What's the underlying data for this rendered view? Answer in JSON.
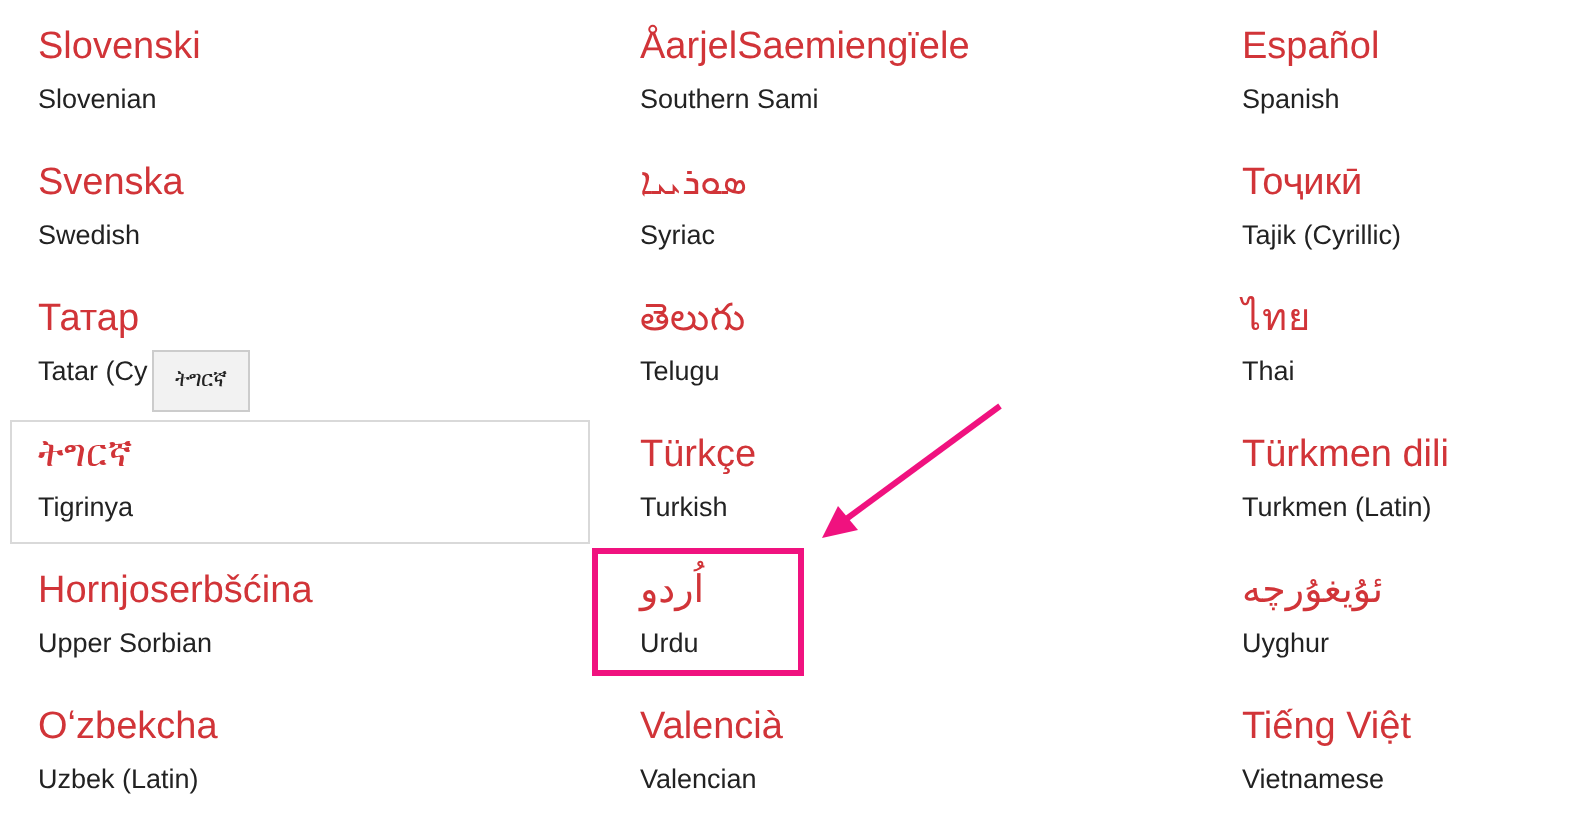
{
  "languages": [
    {
      "native": "Slovenski",
      "english": "Slovenian",
      "hovered": false,
      "highlighted": false
    },
    {
      "native": "ÅarjelSaemiengïele",
      "english": "Southern Sami",
      "hovered": false,
      "highlighted": false
    },
    {
      "native": "Español",
      "english": "Spanish",
      "hovered": false,
      "highlighted": false
    },
    {
      "native": "Svenska",
      "english": "Swedish",
      "hovered": false,
      "highlighted": false
    },
    {
      "native": "ܣܘܪܝܝܐ",
      "english": "Syriac",
      "hovered": false,
      "highlighted": false
    },
    {
      "native": "Тоҷикӣ",
      "english": "Tajik (Cyrillic)",
      "hovered": false,
      "highlighted": false
    },
    {
      "native": "Татар",
      "english": "Tatar (Cy",
      "hovered": false,
      "highlighted": false
    },
    {
      "native": "తెలుగు",
      "english": "Telugu",
      "hovered": false,
      "highlighted": false
    },
    {
      "native": "ไทย",
      "english": "Thai",
      "hovered": false,
      "highlighted": false
    },
    {
      "native": "ትግርኛ",
      "english": "Tigrinya",
      "hovered": true,
      "highlighted": false
    },
    {
      "native": "Türkçe",
      "english": "Turkish",
      "hovered": false,
      "highlighted": false
    },
    {
      "native": "Türkmen dili",
      "english": "Turkmen (Latin)",
      "hovered": false,
      "highlighted": false
    },
    {
      "native": "Hornjoserbšćina",
      "english": "Upper Sorbian",
      "hovered": false,
      "highlighted": false
    },
    {
      "native": "اُردو",
      "english": "Urdu",
      "hovered": false,
      "highlighted": true
    },
    {
      "native": "ئۇيغۇرچە",
      "english": "Uyghur",
      "hovered": false,
      "highlighted": false
    },
    {
      "native": "Oʻzbekcha",
      "english": "Uzbek (Latin)",
      "hovered": false,
      "highlighted": false
    },
    {
      "native": "Valencià",
      "english": "Valencian",
      "hovered": false,
      "highlighted": false
    },
    {
      "native": "Tiếng Việt",
      "english": "Vietnamese",
      "hovered": false,
      "highlighted": false
    }
  ],
  "tooltip": {
    "text": "ትግርኛ"
  }
}
